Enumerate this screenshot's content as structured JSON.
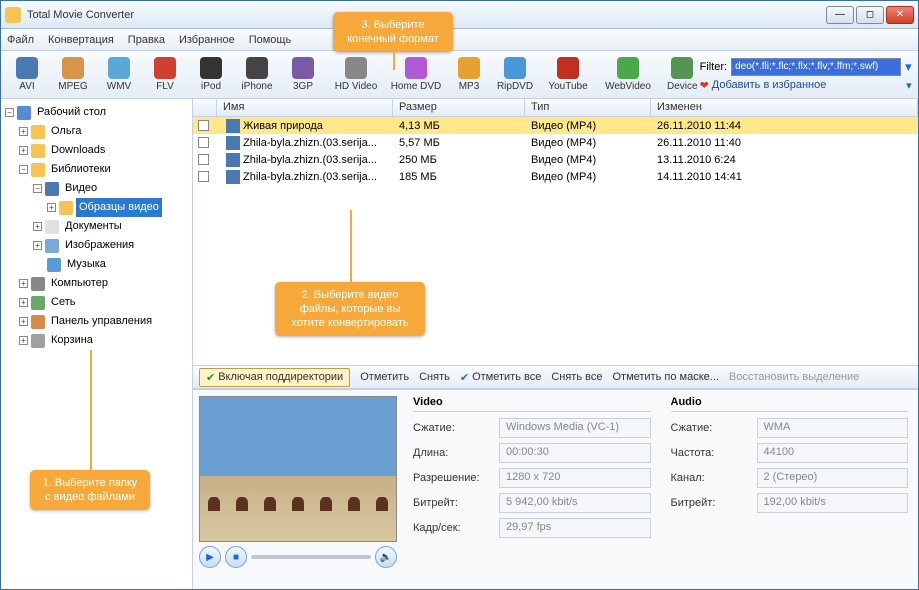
{
  "window": {
    "title": "Total Movie Converter"
  },
  "menu": [
    "Файл",
    "Конвертация",
    "Правка",
    "Избранное",
    "Помощь"
  ],
  "toolbar": [
    {
      "label": "AVI",
      "ic": "ic-avi"
    },
    {
      "label": "MPEG",
      "ic": "ic-mpeg"
    },
    {
      "label": "WMV",
      "ic": "ic-wmv"
    },
    {
      "label": "FLV",
      "ic": "ic-flv"
    },
    {
      "label": "iPod",
      "ic": "ic-ipod"
    },
    {
      "label": "iPhone",
      "ic": "ic-iphone"
    },
    {
      "label": "3GP",
      "ic": "ic-3gp"
    },
    {
      "label": "HD Video",
      "ic": "ic-hd",
      "wide": true
    },
    {
      "label": "Home DVD",
      "ic": "ic-dvd",
      "wide": true
    },
    {
      "label": "MP3",
      "ic": "ic-mp3"
    },
    {
      "label": "RipDVD",
      "ic": "ic-rip"
    },
    {
      "label": "YouTube",
      "ic": "ic-yt",
      "wide": true
    },
    {
      "label": "WebVideo",
      "ic": "ic-web",
      "wide": true
    }
  ],
  "device_btn": "Device",
  "filter": {
    "label": "Filter:",
    "value": "deo(*.fli;*.flc;*.flx;*.flv;*.ffm;*.swf)"
  },
  "favorites": "Добавить в избранное",
  "tree": {
    "root": "Рабочий стол",
    "olga": "Ольга",
    "downloads": "Downloads",
    "libraries": "Библиотеки",
    "video": "Видео",
    "samples": "Образцы видео",
    "documents": "Документы",
    "images": "Изображения",
    "music": "Музыка",
    "computer": "Компьютер",
    "network": "Сеть",
    "control": "Панель управления",
    "bin": "Корзина"
  },
  "columns": {
    "name": "Имя",
    "size": "Размер",
    "type": "Тип",
    "modified": "Изменен"
  },
  "files": [
    {
      "name": "Живая природа",
      "size": "4,13 МБ",
      "type": "Видео (MP4)",
      "mod": "26.11.2010 11:44",
      "sel": true
    },
    {
      "name": "Zhila-byla.zhizn.(03.serija...",
      "size": "5,57 МБ",
      "type": "Видео (MP4)",
      "mod": "26.11.2010 11:40"
    },
    {
      "name": "Zhila-byla.zhizn.(03.serija...",
      "size": "250 МБ",
      "type": "Видео (MP4)",
      "mod": "13.11.2010 6:24"
    },
    {
      "name": "Zhila-byla.zhizn.(03.serija...",
      "size": "185 МБ",
      "type": "Видео (MP4)",
      "mod": "14.11.2010 14:41"
    }
  ],
  "actions": {
    "subdirs": "Включая поддиректории",
    "check": "Отметить",
    "uncheck": "Снять",
    "checkall": "Отметить все",
    "uncheckall": "Снять все",
    "bymask": "Отметить по маске...",
    "restore": "Восстановить выделение"
  },
  "video": {
    "header": "Video",
    "compression_l": "Сжатие:",
    "compression": "Windows Media (VC-1)",
    "length_l": "Длина:",
    "length": "00:00:30",
    "res_l": "Разрешение:",
    "res": "1280 x 720",
    "bitrate_l": "Битрейт:",
    "bitrate": "5 942,00 kbit/s",
    "fps_l": "Кадр/сек:",
    "fps": "29,97 fps"
  },
  "audio": {
    "header": "Audio",
    "compression_l": "Сжатие:",
    "compression": "WMA",
    "freq_l": "Частота:",
    "freq": "44100",
    "channel_l": "Канал:",
    "channel": "2 (Стерео)",
    "bitrate_l": "Битрейт:",
    "bitrate": "192,00 kbit/s"
  },
  "callouts": {
    "c1": "1. Выберите папку с видео файлами",
    "c2": "2. Выберите видео файлы, которые вы хотите конвертировать",
    "c3": "3. Выберите конечный формат"
  },
  "col_widths": {
    "chk": 24,
    "name": 176,
    "size": 132,
    "type": 126,
    "mod": 150
  }
}
